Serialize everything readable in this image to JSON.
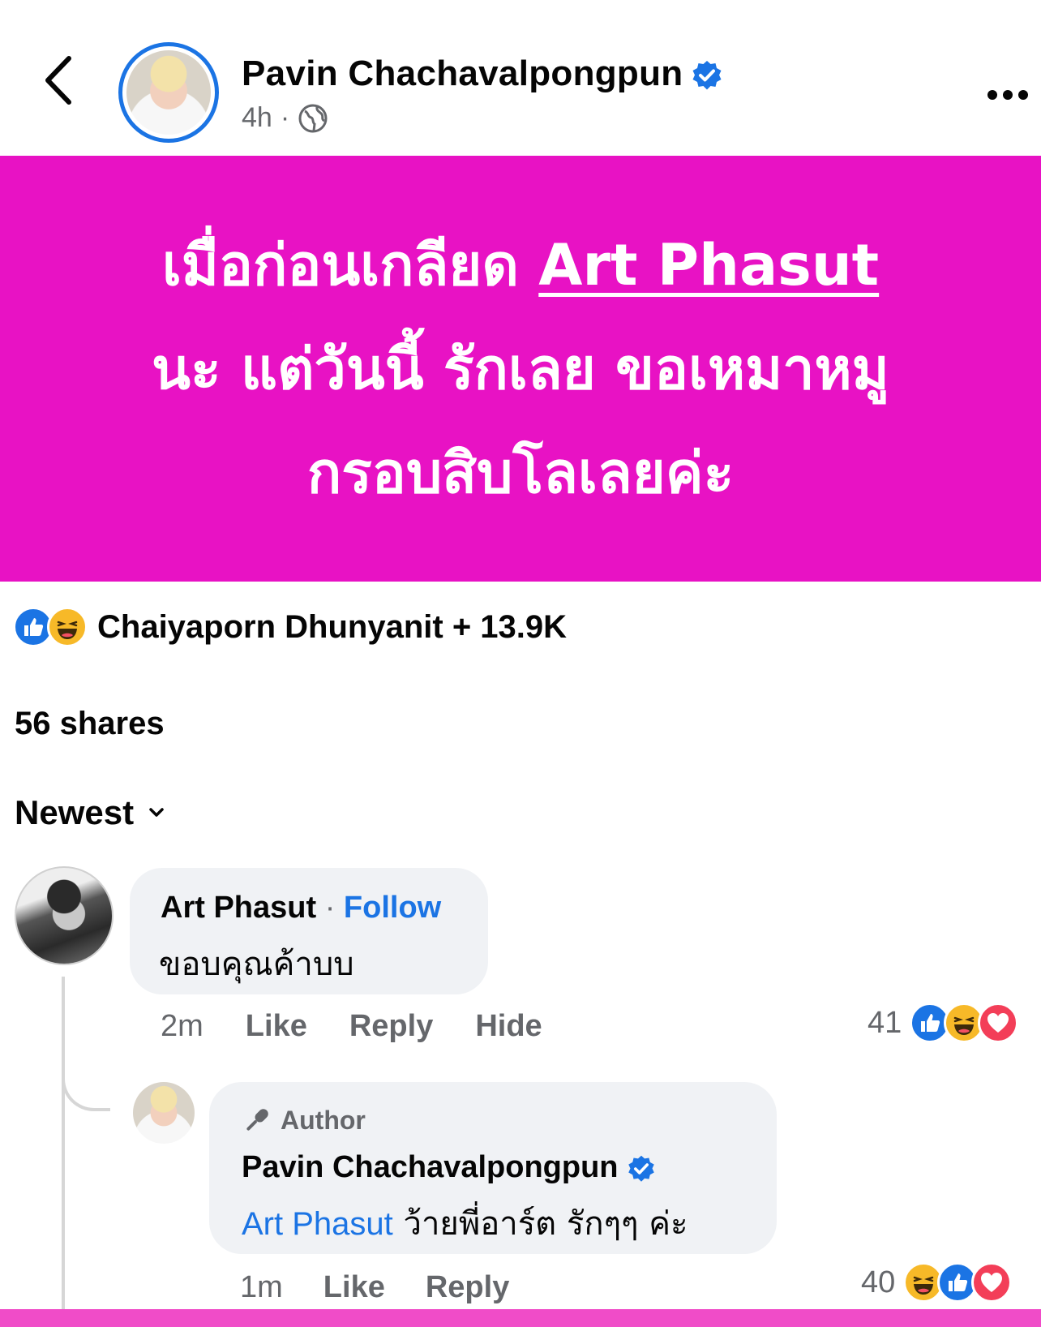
{
  "post": {
    "author_name": "Pavin Chachavalpongpun",
    "time": "4h",
    "separator": "·",
    "image_lines": [
      {
        "pre": "เมื่อก่อนเกลียด ",
        "underlined": "Art Phasut"
      },
      {
        "pre": "นะ แต่วันนี้ รักเลย ขอเหมาหมู",
        "underlined": ""
      },
      {
        "pre": "กรอบสิบโลเลยค่ะ",
        "underlined": ""
      }
    ],
    "image_color": "#e812c4"
  },
  "reactions": {
    "text": "Chaiyaporn Dhunyanit + 13.9K",
    "icons": [
      "like-icon",
      "haha-icon"
    ]
  },
  "shares": "56 shares",
  "sort": {
    "label": "Newest"
  },
  "comments": [
    {
      "name": "Art Phasut",
      "separator": "·",
      "follow": "Follow",
      "text": "ขอบคุณค้าบบ",
      "time": "2m",
      "actions": [
        "Like",
        "Reply",
        "Hide"
      ],
      "reaction_count": "41",
      "reaction_icons": [
        "like-icon",
        "haha-icon",
        "love-icon"
      ]
    },
    {
      "badge": "Author",
      "name": "Pavin Chachavalpongpun",
      "mention": "Art Phasut",
      "text": " ว้ายพี่อาร์ต รักๆๆ ค่ะ",
      "time": "1m",
      "actions": [
        "Like",
        "Reply"
      ],
      "reaction_count": "40",
      "reaction_icons": [
        "haha-icon",
        "like-icon",
        "love-icon"
      ]
    }
  ],
  "colors": {
    "accent": "#1b74e4",
    "secondary_text": "#65676b",
    "bubble": "#f0f2f5"
  }
}
